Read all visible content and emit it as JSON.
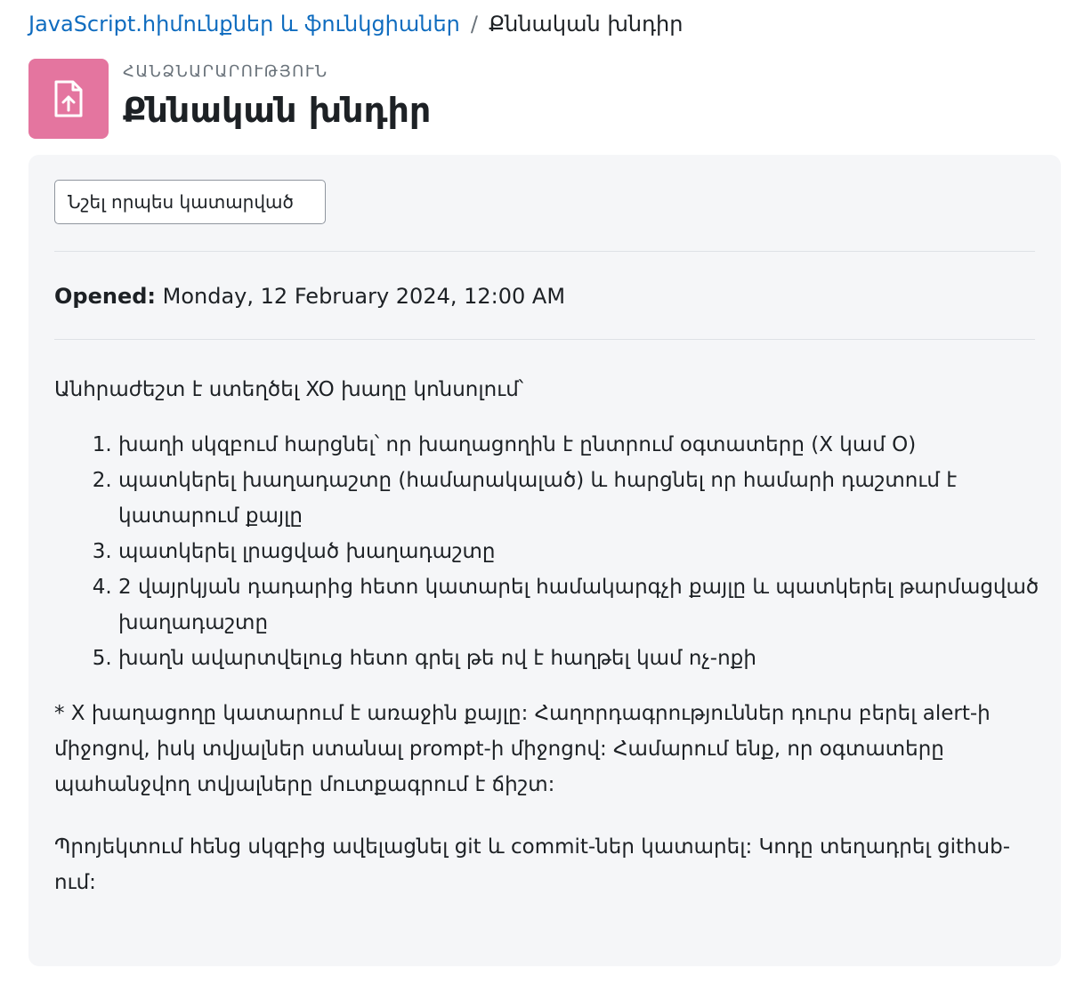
{
  "breadcrumb": {
    "course": "JavaScript.հիմունքներ և ֆունկցիաներ",
    "separator": "/",
    "current": "Քննական խնդիր"
  },
  "header": {
    "activity_type": "ՀԱՆՁՆԱՐԱՐՈՒԹՅՈՒՆ",
    "title": "Քննական խնդիր",
    "icon": "assignment-upload-icon",
    "icon_color": "#e4759f"
  },
  "completion": {
    "button_label": "Նշել որպես կատարված"
  },
  "dates": {
    "opened_label": "Opened:",
    "opened_value": "Monday, 12 February 2024, 12:00 AM"
  },
  "description": {
    "intro": "Անհրաժեշտ է ստեղծել XO խաղը կոնսոլում՝",
    "steps": [
      "խաղի սկզբում հարցնել՝ որ խաղացողին է ընտրում օգտատերը (X կամ O)",
      "պատկերել խաղադաշտը (համարակալած) և հարցնել որ համարի դաշտում է կատարում քայլը",
      "պատկերել լրացված խաղադաշտը",
      "2 վայրկյան դադարից հետո կատարել համակարգչի քայլը և պատկերել թարմացված խաղադաշտը",
      "խաղն ավարտվելուց հետո գրել թե ով է հաղթել կամ ոչ-ոքի"
    ],
    "note": "* X խաղացողը կատարում է առաջին քայլը: Հաղորդագրություններ դուրս բերել alert-ի միջոցով, իսկ տվյալներ ստանալ prompt-ի միջոցով: Համարում ենք, որ օգտատերը պահանջվող տվյալները մուտքագրում է ճիշտ:",
    "project": "Պրոյեկտում հենց սկզբից ավելացնել git և commit-ներ կատարել: Կոդը տեղադրել github-ում:"
  }
}
